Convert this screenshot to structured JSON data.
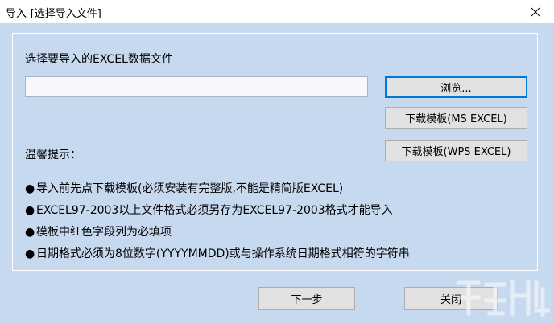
{
  "window": {
    "title": "导入-[选择导入文件]"
  },
  "form": {
    "select_label": "选择要导入的EXCEL数据文件",
    "file_value": "",
    "browse_label": "浏览...",
    "download_ms_label": "下载模板(MS EXCEL)",
    "download_wps_label": "下载模板(WPS EXCEL)"
  },
  "tips": {
    "title": "温馨提示：",
    "bullet": "●",
    "items": [
      "导入前先点下载模板(必须安装有完整版,不能是精简版EXCEL)",
      "EXCEL97-2003以上文件格式必须另存为EXCEL97-2003格式才能导入",
      "模板中红色字段列为必填项",
      "日期格式必须为8位数字(YYYYMMDD)或与操作系统日期格式相符的字符串"
    ]
  },
  "footer": {
    "next_label": "下一步",
    "close_label": "关闭"
  },
  "colors": {
    "client_bg": "#c6d9ef",
    "focus_border": "#0078d7"
  }
}
